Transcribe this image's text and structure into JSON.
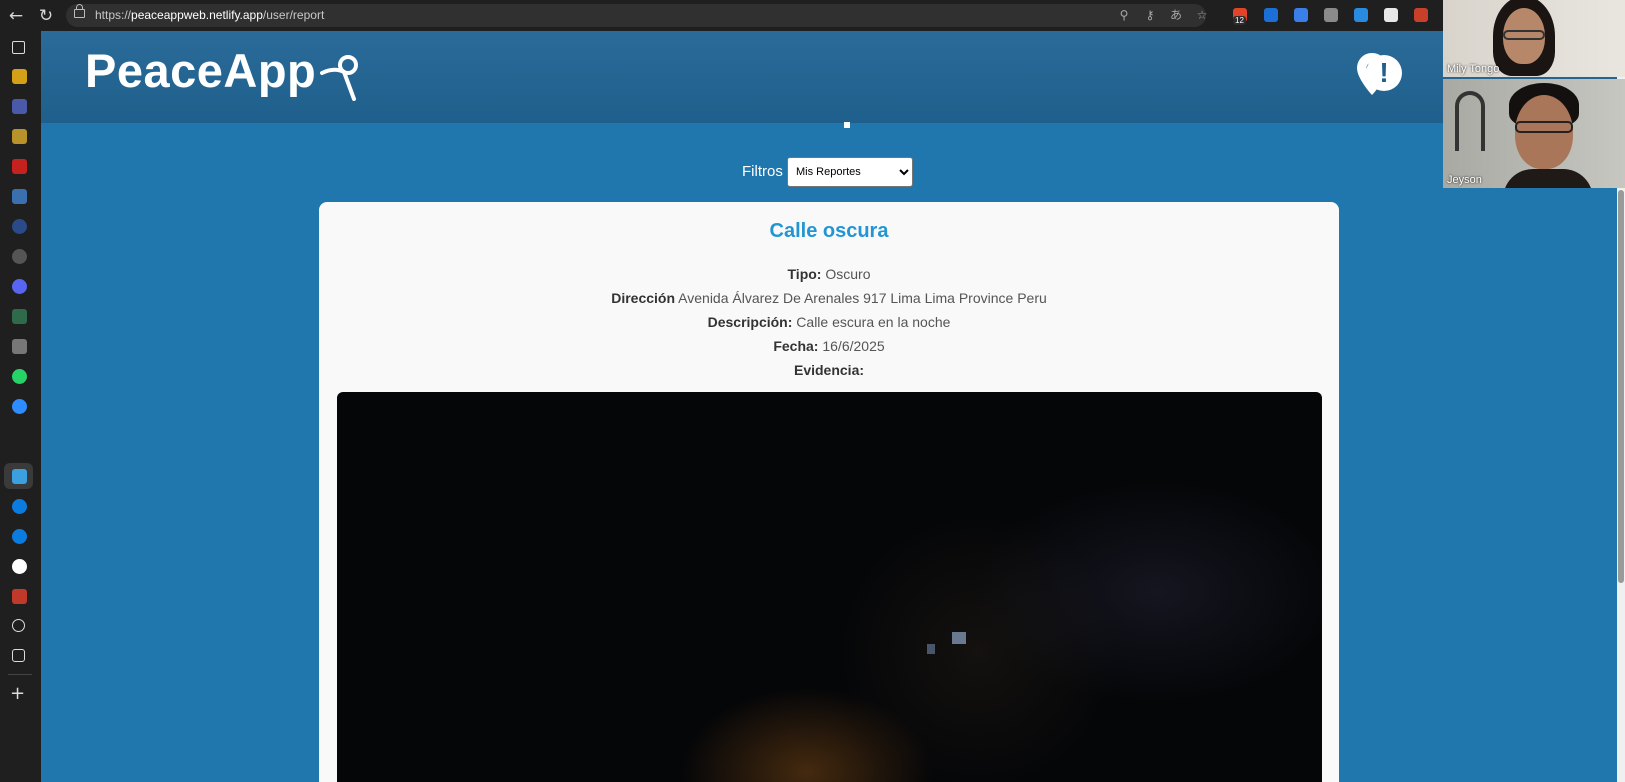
{
  "browser": {
    "url_prefix": "https://",
    "url_host": "peaceappweb.netlify.app",
    "url_path": "/user/report",
    "extension_badge": "12"
  },
  "app": {
    "logo_text": "PeaceApp",
    "brand_color": "#2077ad",
    "accent_color": "#2495d3"
  },
  "filters": {
    "label": "Filtros",
    "selected": "Mis Reportes"
  },
  "report": {
    "title": "Calle oscura",
    "tipo_label": "Tipo:",
    "tipo_value": "Oscuro",
    "direccion_label": "Dirección",
    "direccion_value": "Avenida Álvarez De Arenales 917 Lima Lima Province Peru",
    "descripcion_label": "Descripción:",
    "descripcion_value": "Calle escura en la noche",
    "fecha_label": "Fecha:",
    "fecha_value": "16/6/2025",
    "evidencia_label": "Evidencia:"
  },
  "participants": [
    {
      "name": "Mily Tongo"
    },
    {
      "name": "Jeyson"
    }
  ]
}
